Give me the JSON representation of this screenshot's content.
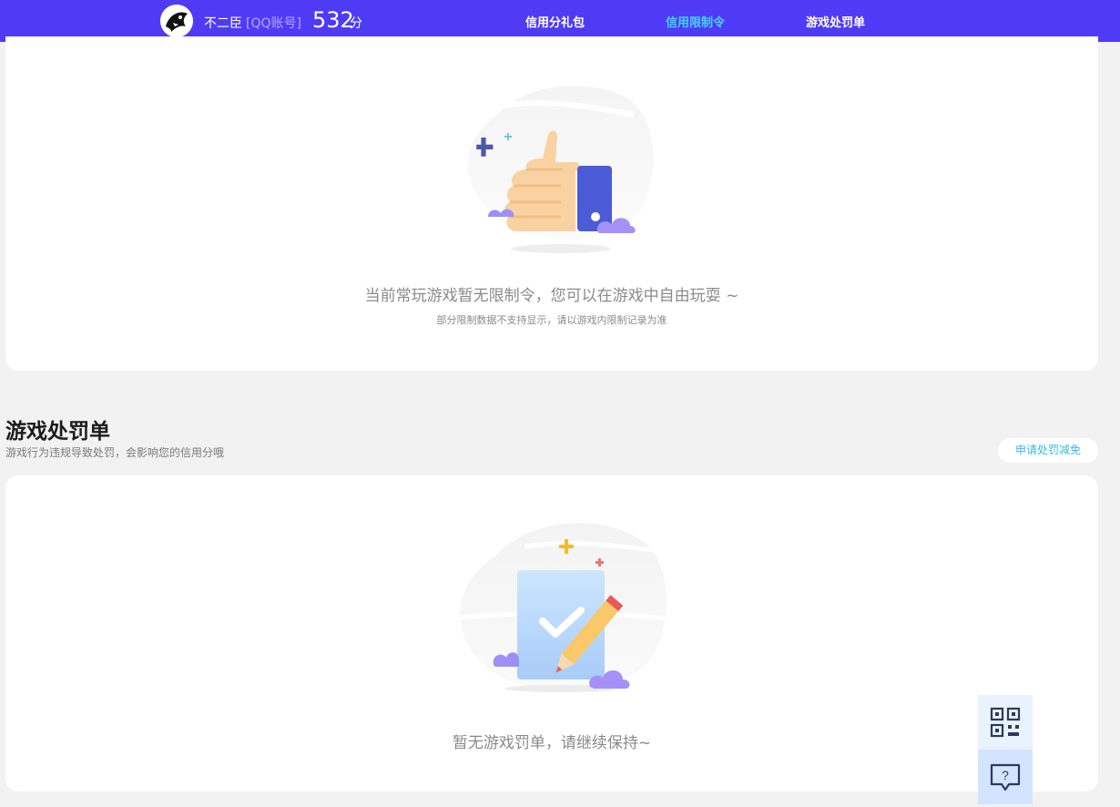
{
  "header": {
    "user_name": "不二臣",
    "account_type": "[QQ账号]",
    "score": "532",
    "score_unit": "分",
    "nav": [
      {
        "label": "信用分礼包",
        "active": false
      },
      {
        "label": "信用限制令",
        "active": true
      },
      {
        "label": "游戏处罚单",
        "active": false
      }
    ]
  },
  "restriction_card": {
    "title": "当前常玩游戏暂无限制令，您可以在游戏中自由玩耍 ~",
    "subtitle": "部分限制数据不支持显示，请以游戏内限制记录为准"
  },
  "penalty_section": {
    "title": "游戏处罚单",
    "description": "游戏行为违规导致处罚，会影响您的信用分哦",
    "appeal_label": "申请处罚减免",
    "empty_text": "暂无游戏罚单，请继续保持~"
  },
  "colors": {
    "header_bg": "#4f3bf5",
    "active_nav": "#45d3ff",
    "appeal_text": "#3ab8e6"
  },
  "floating": {
    "qr_icon": "qr-code-icon",
    "help_icon": "help-chat-icon"
  }
}
